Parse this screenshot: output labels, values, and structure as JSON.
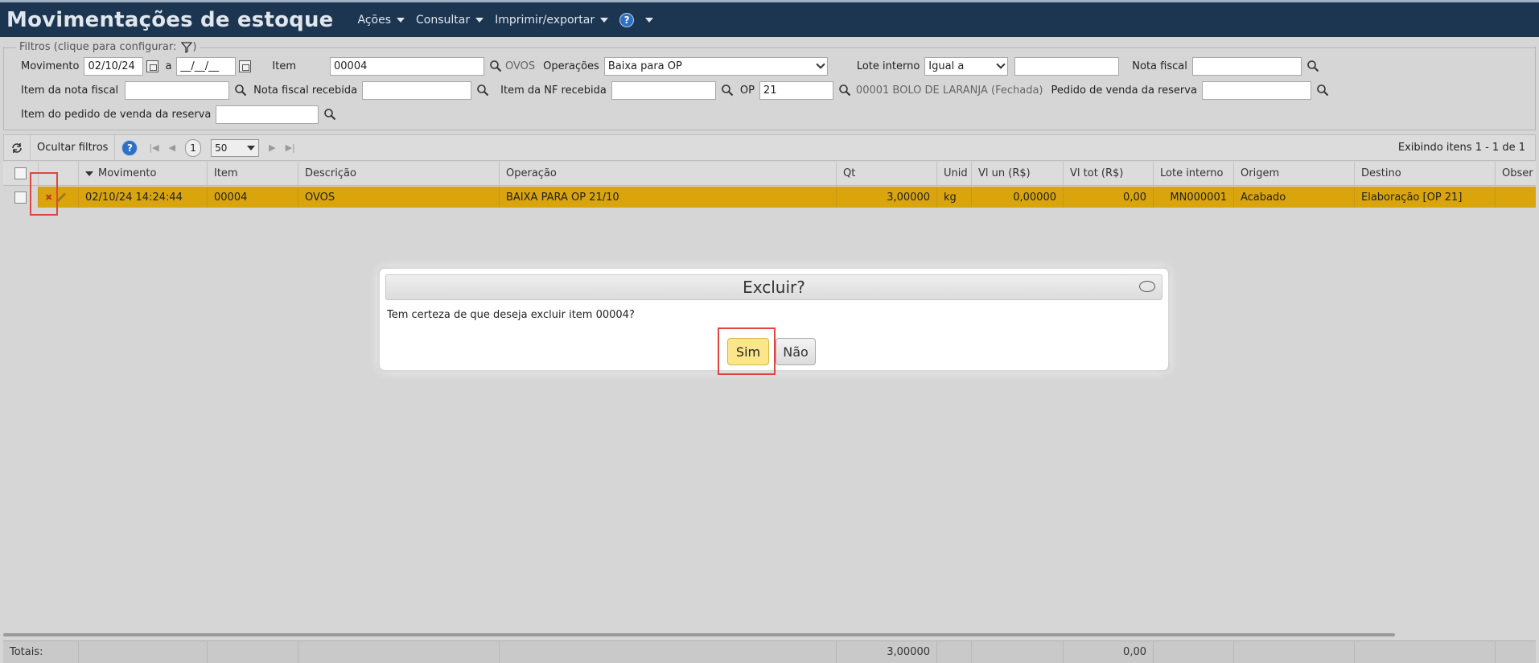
{
  "header": {
    "title": "Movimentações de estoque",
    "menus": [
      "Ações",
      "Consultar",
      "Imprimir/exportar"
    ],
    "help": "?"
  },
  "filters": {
    "legend": "Filtros (clique para configurar:",
    "legend_end": ")",
    "movimento_label": "Movimento",
    "movimento_from": "02/10/24",
    "separator": "a",
    "movimento_to": "__/__/__",
    "item_label": "Item",
    "item_value": "00004",
    "item_desc": "OVOS",
    "operacoes_label": "Operações",
    "operacoes_value": "Baixa para OP",
    "lote_label": "Lote interno",
    "lote_cond": "Igual a",
    "lote_value": "",
    "nota_label": "Nota fiscal",
    "nota_value": "",
    "item_nota_label": "Item da nota fiscal",
    "nota_recebida_label": "Nota fiscal recebida",
    "item_nf_label": "Item da NF recebida",
    "op_label": "OP",
    "op_value": "21",
    "op_desc": "00001 BOLO DE LARANJA (Fechada)",
    "pedido_label": "Pedido de venda da reserva",
    "item_pedido_label": "Item do pedido de venda da reserva"
  },
  "toolbar": {
    "hide_filters": "Ocultar filtros",
    "page": "1",
    "page_size": "50",
    "status": "Exibindo itens 1 - 1 de 1"
  },
  "grid": {
    "columns": [
      "Movimento",
      "Item",
      "Descrição",
      "Operação",
      "Qt",
      "Unid",
      "Vl un (R$)",
      "Vl tot (R$)",
      "Lote interno",
      "Origem",
      "Destino",
      "Obser"
    ],
    "rows": [
      {
        "movimento": "02/10/24 14:24:44",
        "item": "00004",
        "descricao": "OVOS",
        "operacao": "BAIXA PARA OP 21/10",
        "qt": "3,00000",
        "unid": "kg",
        "vl_un": "0,00000",
        "vl_tot": "0,00",
        "lote": "MN000001",
        "origem": "Acabado",
        "destino": "Elaboração [OP 21]"
      }
    ],
    "totals_label": "Totais:",
    "totals_qt": "3,00000",
    "totals_vl_tot": "0,00"
  },
  "dialog": {
    "title": "Excluir?",
    "message": "Tem certeza de que deseja excluir item 00004?",
    "yes": "Sim",
    "no": "Não"
  },
  "colors": {
    "header_bg": "#1c3550",
    "row_selected": "#d9a40c",
    "highlight": "#e0463f",
    "yes_button": "#fde68a"
  }
}
